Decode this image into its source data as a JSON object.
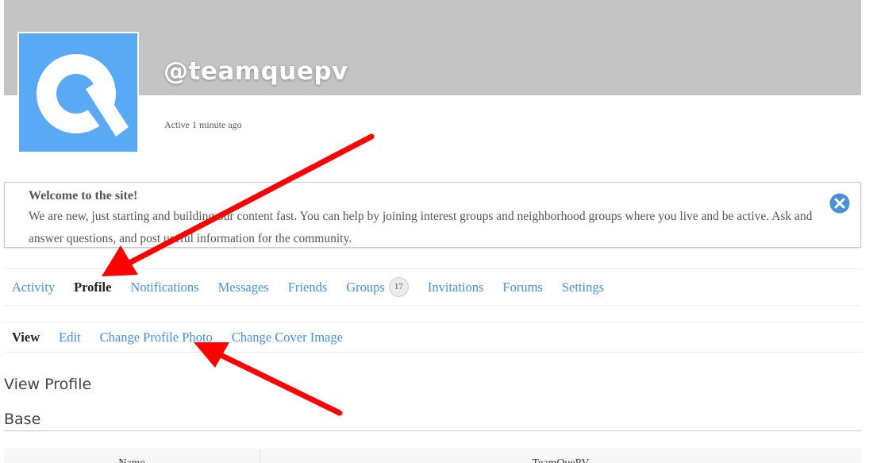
{
  "header": {
    "username": "@teamquepv",
    "activity": "Active 1 minute ago",
    "avatar_letter": "Q",
    "avatar_color": "#5aa9f5",
    "cover_color": "#c4c4c4"
  },
  "notice": {
    "title": "Welcome to the site!",
    "body": "We are new, just starting and building our content fast. You can help by joining interest groups and neighborhood groups where you live and be active. Ask and answer questions, and post useful information for the community.",
    "close_icon": "close-circle-icon",
    "close_color": "#4a90d9"
  },
  "nav": {
    "items": [
      {
        "label": "Activity"
      },
      {
        "label": "Profile"
      },
      {
        "label": "Notifications"
      },
      {
        "label": "Messages"
      },
      {
        "label": "Friends"
      },
      {
        "label": "Groups",
        "count": "17"
      },
      {
        "label": "Invitations"
      },
      {
        "label": "Forums"
      },
      {
        "label": "Settings"
      }
    ],
    "link_color": "#4a90d9"
  },
  "subnav": {
    "items": [
      {
        "label": "View"
      },
      {
        "label": "Edit"
      },
      {
        "label": "Change Profile Photo"
      },
      {
        "label": "Change Cover Image"
      }
    ]
  },
  "content": {
    "section_title": "View Profile",
    "group_title": "Base",
    "fields": [
      {
        "label": "Name",
        "value": "TeamQuePV"
      }
    ]
  },
  "annotations": {
    "arrow_color": "#ff0000"
  }
}
